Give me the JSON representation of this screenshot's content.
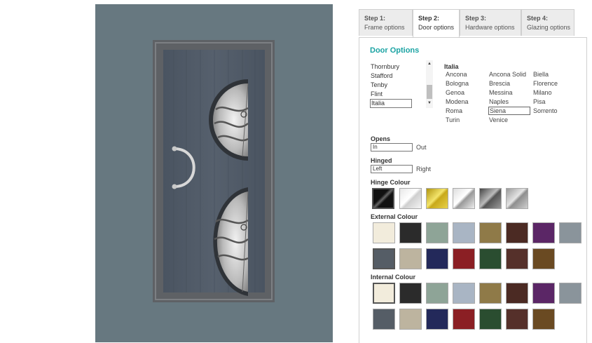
{
  "tabs": [
    {
      "step": "Step 1:",
      "name": "Frame options"
    },
    {
      "step": "Step 2:",
      "name": "Door options"
    },
    {
      "step": "Step 3:",
      "name": "Hardware options"
    },
    {
      "step": "Step 4:",
      "name": "Glazing options"
    }
  ],
  "active_tab": "Door options",
  "heading": "Door Options",
  "range_list": {
    "items": [
      "Thornbury",
      "Stafford",
      "Tenby",
      "Flint",
      "Italia"
    ],
    "selected": "Italia"
  },
  "range_title": "Italia",
  "models": [
    [
      "Ancona",
      "Ancona Solid",
      "Biella"
    ],
    [
      "Bologna",
      "Brescia",
      "Florence"
    ],
    [
      "Genoa",
      "Messina",
      "Milano"
    ],
    [
      "Modena",
      "Naples",
      "Pisa"
    ],
    [
      "Roma",
      "Siena",
      "Sorrento"
    ],
    [
      "Turin",
      "Venice",
      ""
    ]
  ],
  "selected_model": "Siena",
  "opens": {
    "label": "Opens",
    "selected": "In",
    "other": "Out"
  },
  "hinged": {
    "label": "Hinged",
    "selected": "Left",
    "other": "Right"
  },
  "hinge_colour": {
    "label": "Hinge Colour"
  },
  "external_colour": {
    "label": "External Colour"
  },
  "internal_colour": {
    "label": "Internal Colour"
  },
  "colors": {
    "accent": "#1aa3a3",
    "preview_background": "#677880",
    "door_panel": "#4e5865",
    "door_frame": "#5e6165"
  }
}
